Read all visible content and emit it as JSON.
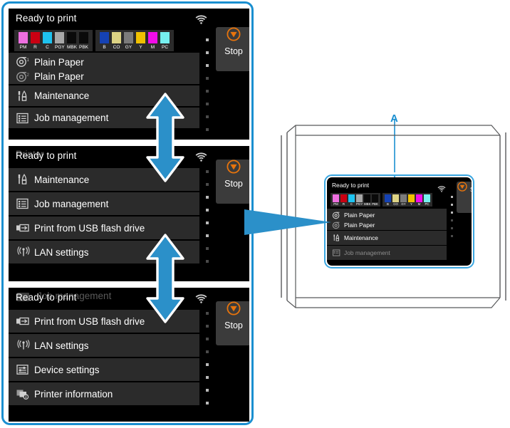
{
  "theme": {
    "accent_blue": "#1a8fd0",
    "screen_bg": "#000000",
    "row_bg": "#2b2b2b",
    "stop_orange": "#e8740c",
    "text_white": "#ffffff"
  },
  "screen": {
    "status_text": "Ready to print",
    "wifi_icon": "wifi-icon",
    "stop_button": {
      "label": "Stop",
      "icon": "stop-icon"
    }
  },
  "inks": {
    "group1": [
      {
        "code": "PM",
        "color": "#ee6fe0"
      },
      {
        "code": "R",
        "color": "#c90012"
      },
      {
        "code": "C",
        "color": "#1ec3f0"
      },
      {
        "code": "PGY",
        "color": "#a8a8a8"
      },
      {
        "code": "MBK",
        "color": "#0a0a0a"
      },
      {
        "code": "PBK",
        "color": "#0a0a0a"
      }
    ],
    "group2": [
      {
        "code": "B",
        "color": "#1542b4"
      },
      {
        "code": "CO",
        "color": "#ddd384"
      },
      {
        "code": "GY",
        "color": "#7b7b7b"
      },
      {
        "code": "Y",
        "color": "#f0c000"
      },
      {
        "code": "M",
        "color": "#f20ce8"
      },
      {
        "code": "PC",
        "color": "#76f0f0"
      }
    ]
  },
  "menu_items": {
    "paper1": {
      "label": "Plain Paper",
      "icon": "roll-paper-1-icon"
    },
    "paper2": {
      "label": "Plain Paper",
      "icon": "roll-paper-2-icon"
    },
    "maintenance": {
      "label": "Maintenance",
      "icon": "maintenance-tools-icon"
    },
    "job_management": {
      "label": "Job management",
      "icon": "job-list-icon"
    },
    "usb_print": {
      "label": "Print from USB flash drive",
      "icon": "usb-drive-icon"
    },
    "lan_settings": {
      "label": "LAN settings",
      "icon": "lan-antenna-icon"
    },
    "device_settings": {
      "label": "Device settings",
      "icon": "sliders-icon"
    },
    "printer_information": {
      "label": "Printer information",
      "icon": "printer-info-icon"
    }
  },
  "panels": [
    {
      "name": "panel-top",
      "ghost_row": {
        "label": "Print from USB flash drive",
        "visible": false
      },
      "scroll_position": "top"
    },
    {
      "name": "panel-middle",
      "ghost_row": {
        "label": "Printer",
        "visible": true
      },
      "scroll_position": "middle"
    },
    {
      "name": "panel-bottom",
      "ghost_row": {
        "label": "Job management",
        "visible": true
      },
      "scroll_position": "bottom"
    }
  ],
  "arrows": {
    "scroll_arrow_1": "double-headed-vertical-arrow",
    "scroll_arrow_2": "double-headed-vertical-arrow",
    "pointer_arrow": "right-pointing-arrow"
  },
  "illustration": {
    "callout_label": "A",
    "callout_name": "operation-panel-callout"
  }
}
